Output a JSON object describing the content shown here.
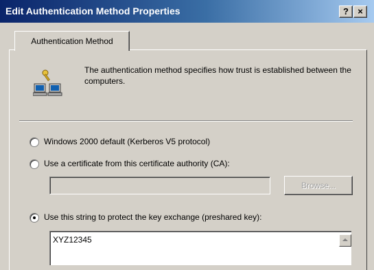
{
  "window": {
    "title": "Edit Authentication Method Properties",
    "help_label": "?",
    "close_label": "×"
  },
  "tab": {
    "label": "Authentication Method"
  },
  "description": "The authentication method specifies how trust is established between the computers.",
  "icons": {
    "header": "computers-key-icon"
  },
  "options": [
    {
      "label": "Windows 2000 default (Kerberos V5 protocol)",
      "checked": false
    },
    {
      "label": "Use a certificate from this certificate authority (CA):",
      "checked": false
    },
    {
      "label": "Use this string to protect the key exchange (preshared key):",
      "checked": true
    }
  ],
  "certificate": {
    "value": "",
    "browse_label": "Browse..."
  },
  "preshared_key": {
    "value": "XYZ12345"
  },
  "colors": {
    "face": "#d4d0c8",
    "title_dark": "#0a246a",
    "title_light": "#a6caf0"
  }
}
